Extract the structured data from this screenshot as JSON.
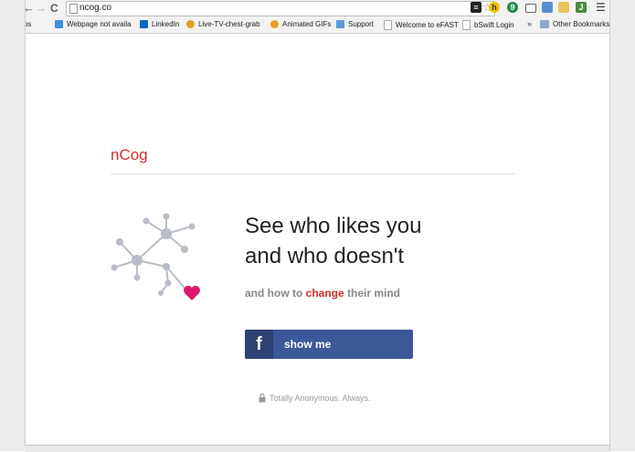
{
  "browser": {
    "url": "ncog.co",
    "bookmarks": [
      {
        "label": "Apps",
        "color": "#5b8fd6"
      },
      {
        "label": "Webpage not availa",
        "color": "#3d8fe0"
      },
      {
        "label": "LinkedIn",
        "color": "#0b66c3"
      },
      {
        "label": "Live-TV-chest-grab",
        "color": "#e6a020"
      },
      {
        "label": "Animated GIFs",
        "color": "#e6a020"
      },
      {
        "label": "Support",
        "color": "#5b9bd5"
      },
      {
        "label": "Welcome to eFAST",
        "color": "#ddd"
      },
      {
        "label": "bSwift Login",
        "color": "#ddd"
      }
    ],
    "overflow_label": "»",
    "other_bookmarks": "Other Bookmarks"
  },
  "page": {
    "logo": "nCog",
    "headline_line1": "See who likes you",
    "headline_line2": "and who doesn't",
    "sub_before": "and how to ",
    "sub_highlight": "change",
    "sub_after": " their mind",
    "button_label": "show me",
    "anon_text": "Totally Anonymous. Always.",
    "accent_color": "#d92b2b",
    "facebook_color": "#3b5998",
    "heart_color": "#e0196e"
  }
}
